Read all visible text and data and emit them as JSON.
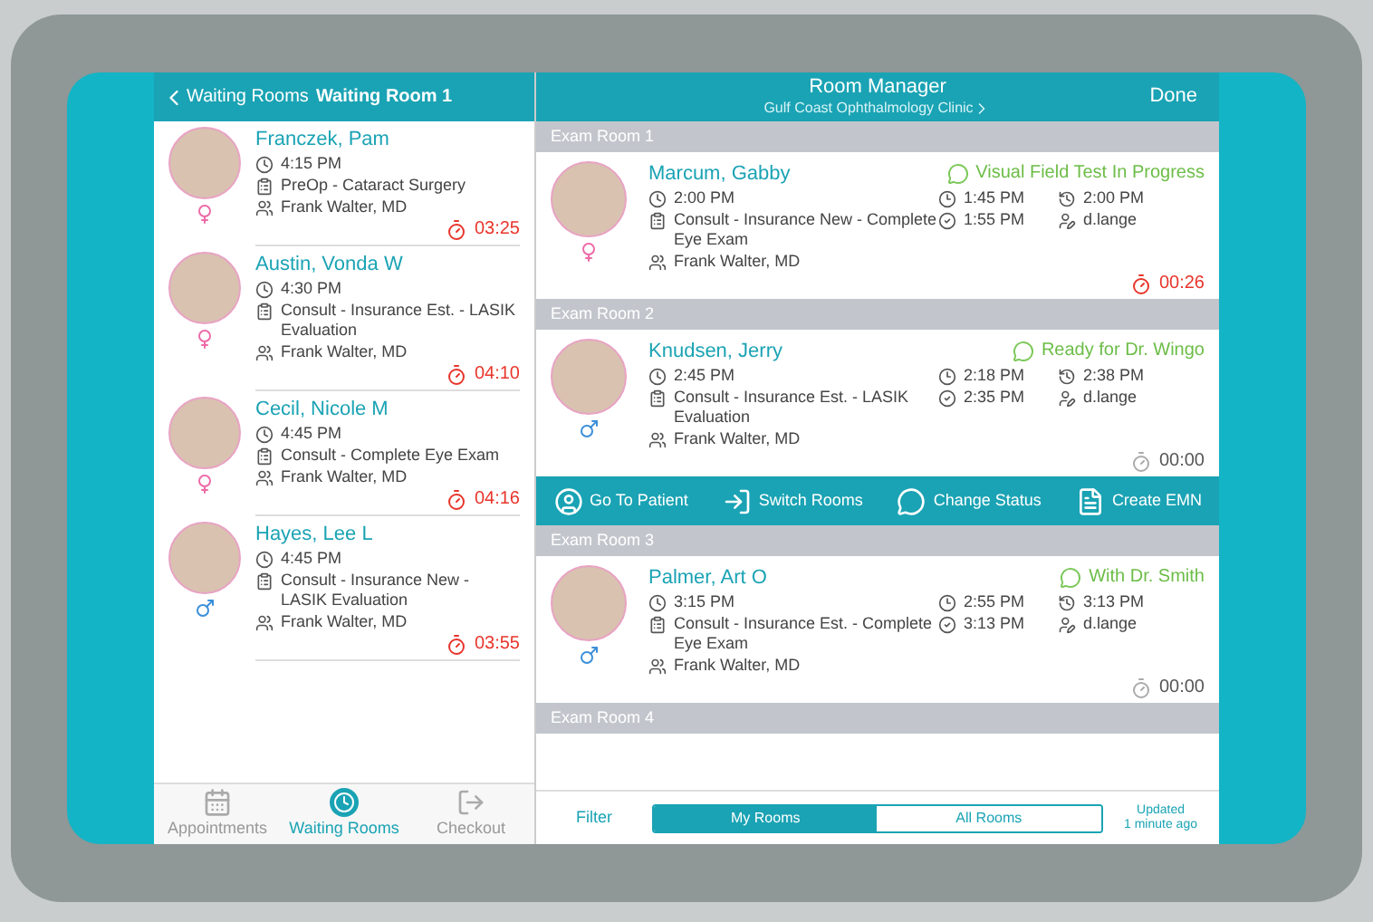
{
  "waiting_panel": {
    "back_label": "Waiting Rooms",
    "title": "Waiting Room 1",
    "patients": [
      {
        "name": "Franczek, Pam",
        "kind": "female",
        "time": "4:15 PM",
        "visit": "PreOp - Cataract Surgery",
        "provider": "Frank Walter, MD",
        "timer": "03:25",
        "alert": true
      },
      {
        "name": "Austin, Vonda W",
        "kind": "female",
        "time": "4:30 PM",
        "visit": "Consult - Insurance Est. - LASIK Evaluation",
        "provider": "Frank Walter, MD",
        "timer": "04:10",
        "alert": true
      },
      {
        "name": "Cecil, Nicole M",
        "kind": "female",
        "time": "4:45 PM",
        "visit": "Consult - Complete Eye Exam",
        "provider": "Frank Walter, MD",
        "timer": "04:16",
        "alert": true
      },
      {
        "name": "Hayes, Lee L",
        "kind": "male",
        "time": "4:45 PM",
        "visit": "Consult - Insurance New - LASIK Evaluation",
        "provider": "Frank Walter, MD",
        "timer": "03:55",
        "alert": true
      }
    ],
    "tabs": [
      {
        "label": "Appointments",
        "kind": "calendar",
        "selected": false
      },
      {
        "label": "Waiting Rooms",
        "kind": "clock",
        "selected": true
      },
      {
        "label": "Checkout",
        "kind": "exit",
        "selected": false
      }
    ]
  },
  "room_manager": {
    "title": "Room Manager",
    "subtitle": "Gulf Coast Ophthalmology Clinic",
    "done": "Done",
    "rooms": [
      {
        "name": "Exam Room 1",
        "patient": {
          "name": "Marcum, Gabby",
          "kind": "female",
          "status": "Visual Field Test In Progress",
          "time": "2:00 PM",
          "visit": "Consult - Insurance New - Complete Eye Exam",
          "provider": "Frank Walter, MD",
          "time_2": "1:45 PM",
          "time_3": "1:55 PM",
          "time_4": "2:00 PM",
          "user": "d.lange",
          "timer": "00:26",
          "alert": true
        }
      },
      {
        "name": "Exam Room 2",
        "patient": {
          "name": "Knudsen, Jerry",
          "kind": "male",
          "status": "Ready for Dr. Wingo",
          "time": "2:45 PM",
          "visit": "Consult - Insurance Est. - LASIK Evaluation",
          "provider": "Frank Walter, MD",
          "time_2": "2:18 PM",
          "time_3": "2:35 PM",
          "time_4": "2:38 PM",
          "user": "d.lange",
          "timer": "00:00",
          "alert": false
        },
        "actions": [
          {
            "label": "Go To Patient",
            "kind": "patient"
          },
          {
            "label": "Switch Rooms",
            "kind": "switch"
          },
          {
            "label": "Change Status",
            "kind": "status"
          },
          {
            "label": "Create EMN",
            "kind": "document"
          }
        ]
      },
      {
        "name": "Exam Room 3",
        "patient": {
          "name": "Palmer, Art O",
          "kind": "male",
          "status": "With Dr. Smith",
          "time": "3:15 PM",
          "visit": "Consult - Insurance Est. - Complete Eye Exam",
          "provider": "Frank Walter, MD",
          "time_2": "2:55 PM",
          "time_3": "3:13 PM",
          "time_4": "3:13 PM",
          "user": "d.lange",
          "timer": "00:00",
          "alert": false
        }
      },
      {
        "name": "Exam Room 4"
      }
    ],
    "footer": {
      "filter": "Filter",
      "segments": [
        {
          "label": "My Rooms",
          "selected": true
        },
        {
          "label": "All Rooms",
          "selected": false
        }
      ],
      "updated": [
        "Updated",
        "1 minute ago"
      ]
    }
  }
}
